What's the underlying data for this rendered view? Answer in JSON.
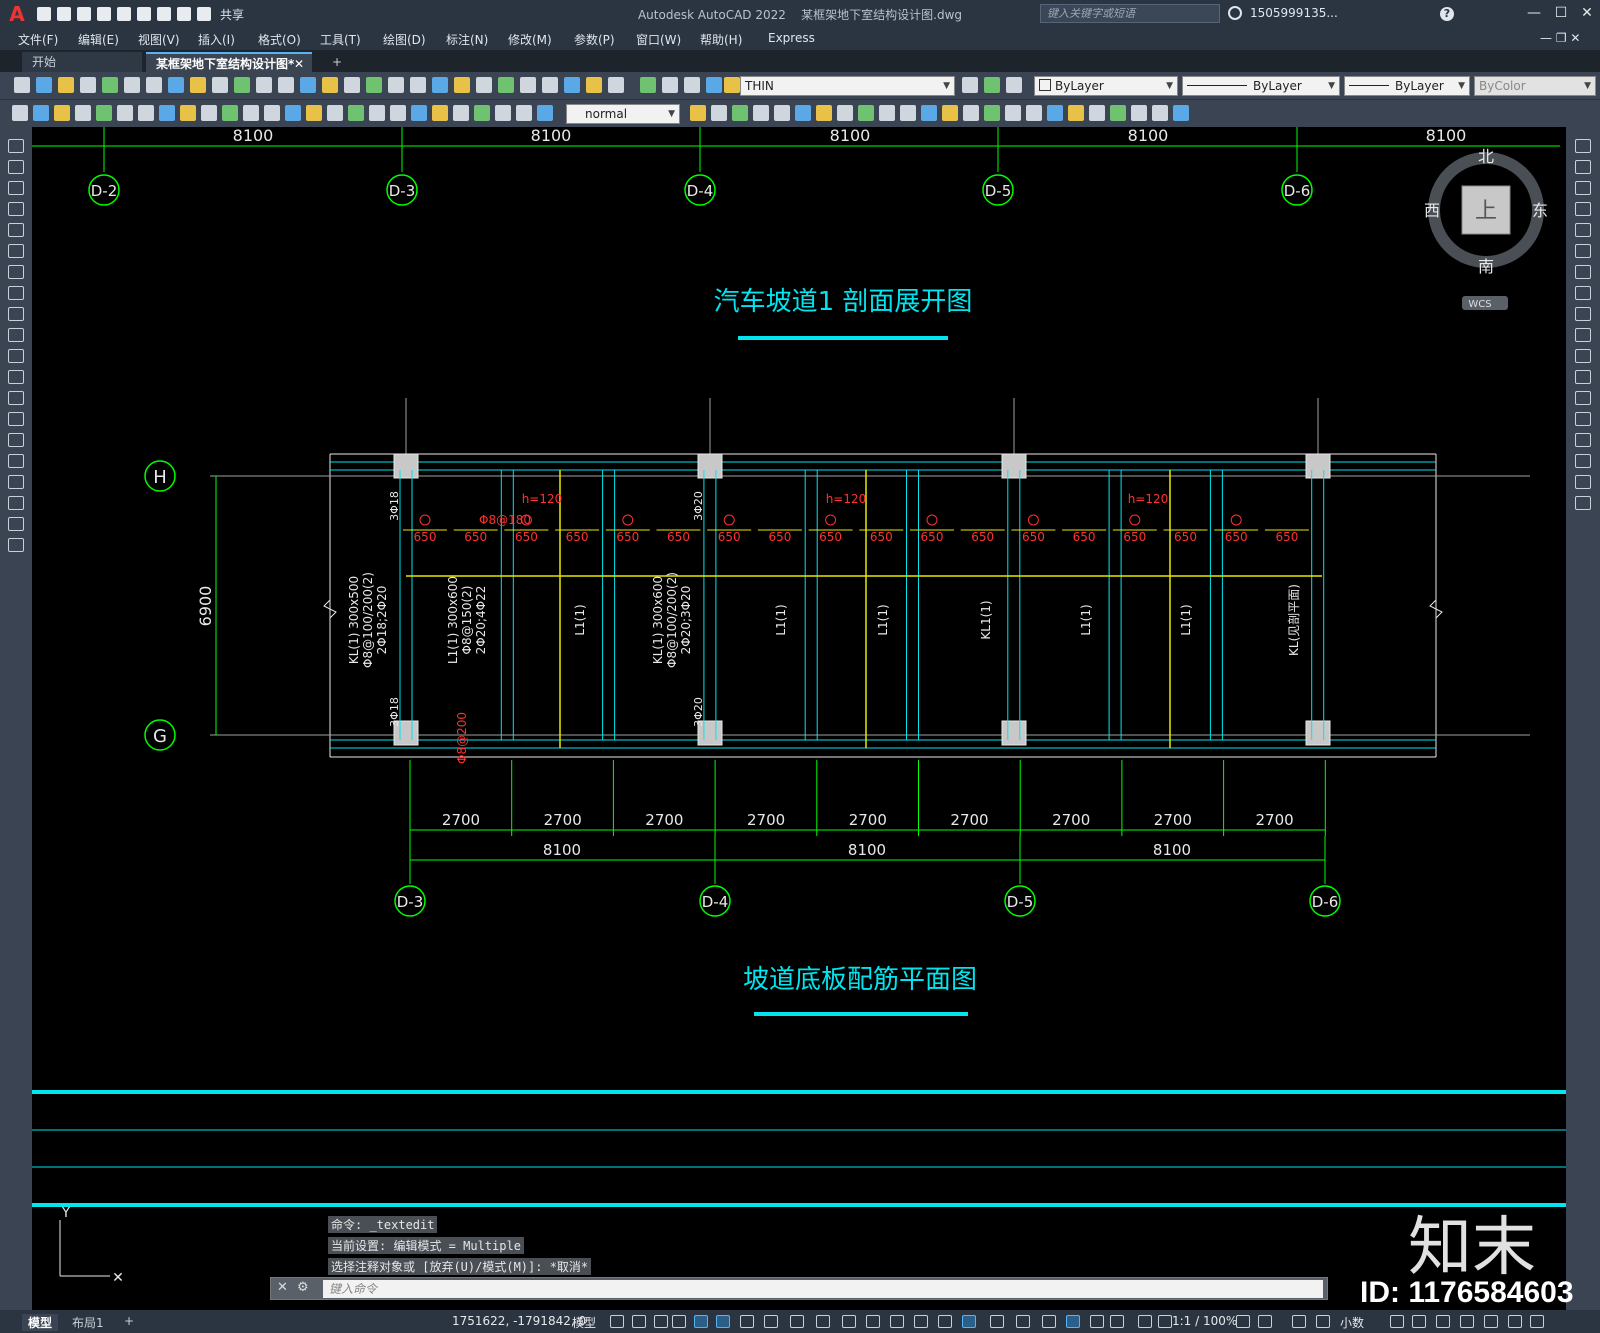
{
  "app": {
    "title": "Autodesk AutoCAD 2022",
    "file": "某框架地下室结构设计图.dwg",
    "share": "共享",
    "search_placeholder": "键入关键字或短语",
    "user": "1505999135..."
  },
  "menu": [
    "文件(F)",
    "编辑(E)",
    "视图(V)",
    "插入(I)",
    "格式(O)",
    "工具(T)",
    "绘图(D)",
    "标注(N)",
    "修改(M)",
    "参数(P)",
    "窗口(W)",
    "帮助(H)",
    "Express"
  ],
  "tabs": [
    {
      "label": "开始",
      "active": false
    },
    {
      "label": "某框架地下室结构设计图*",
      "active": true
    }
  ],
  "toolbar": {
    "layer": "THIN",
    "color": "ByLayer",
    "linetype": "ByLayer",
    "lineweight": "ByLayer",
    "plotstyle": "ByColor",
    "textstyle": "normal"
  },
  "viewcube": {
    "north": "北",
    "south": "南",
    "east": "东",
    "west": "西",
    "face": "上",
    "wcs": "WCS"
  },
  "drawing": {
    "top_dims": [
      "8100",
      "8100",
      "8100",
      "8100",
      "8100"
    ],
    "top_axes": [
      "D-2",
      "D-3",
      "D-4",
      "D-5",
      "D-6"
    ],
    "title1": "汽车坡道1 剖面展开图",
    "title2": "坡道底板配筋平面图",
    "row_axes": [
      "H",
      "G"
    ],
    "span_h": "6900",
    "sub_dims": [
      "2700",
      "2700",
      "2700",
      "2700",
      "2700",
      "2700",
      "2700",
      "2700",
      "2700"
    ],
    "main_dims": [
      "8100",
      "8100",
      "8100"
    ],
    "bottom_axes": [
      "D-3",
      "D-4",
      "D-5",
      "D-6"
    ],
    "h_label": "h=120",
    "rebar_dim": "650",
    "beam_labels": [
      "KL(1) 300x500\nΦ8@100/200(2)\n2Φ18;2Φ20",
      "L1(1) 300x600\nΦ8@150(2)\n2Φ20;4Φ22",
      "L1(1)",
      "KL(1) 300x600\nΦ8@100/200(2)\n2Φ20;3Φ20",
      "L1(1)",
      "L1(1)",
      "KL1(1)",
      "L1(1)",
      "L1(1)",
      "KL(见剖平面)"
    ],
    "col_labels": [
      "3Φ18",
      "3Φ20"
    ],
    "rebar_note": "Φ8@180",
    "rebar_note2": "Φ8@200"
  },
  "command": {
    "history": [
      "命令: _textedit",
      "当前设置: 编辑模式 = Multiple",
      "选择注释对象或 [放弃(U)/模式(M)]: *取消*"
    ],
    "placeholder": "键入命令"
  },
  "status": {
    "model_tab": "模型",
    "layout_tab": "布局1",
    "coords": "1751622, -1791842, 0",
    "mode": "模型",
    "scale": "1:1 / 100%",
    "units": "小数"
  },
  "watermark": {
    "brand": "知末",
    "id": "ID: 1176584603"
  },
  "colors": {
    "axis_green": "#00ff00",
    "cyan": "#00e5ee",
    "red": "#ff3030",
    "yellow": "#e8e800",
    "white": "#e8e8e8",
    "gray": "#a0a0a0"
  }
}
